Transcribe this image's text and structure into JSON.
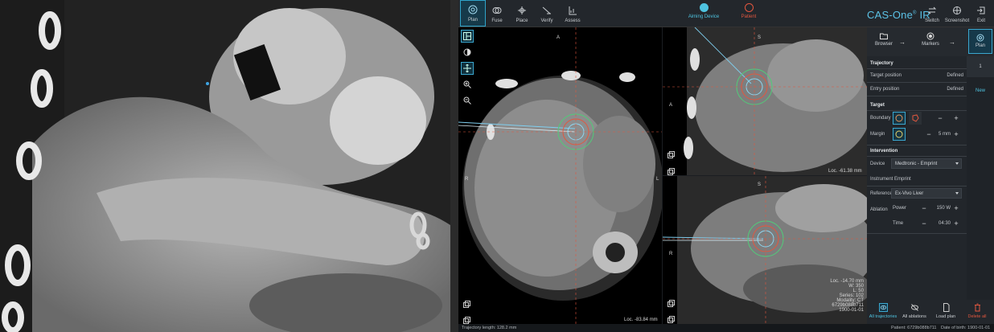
{
  "toolbar": {
    "tools": [
      {
        "label": "Plan",
        "icon": "plan-icon",
        "active": true
      },
      {
        "label": "Fuse",
        "icon": "fuse-icon"
      },
      {
        "label": "Place",
        "icon": "place-icon"
      },
      {
        "label": "Verify",
        "icon": "verify-icon"
      },
      {
        "label": "Assess",
        "icon": "assess-icon"
      }
    ],
    "status": [
      {
        "label": "Aiming Device",
        "color": "#4ec3e0"
      },
      {
        "label": "Patient",
        "color": "#e2573f"
      }
    ],
    "brand": "CAS-One",
    "brand_suffix": "IR",
    "brand_mark": "®",
    "actions": [
      {
        "label": "Switch",
        "icon": "switch-icon"
      },
      {
        "label": "Screenshot",
        "icon": "screenshot-icon"
      },
      {
        "label": "Exit",
        "icon": "exit-icon"
      }
    ]
  },
  "views": {
    "axial": {
      "orient_top": "A",
      "orient_right": "L",
      "orient_left": "R",
      "loc": "Loc. -83.84 mm"
    },
    "sagittal": {
      "orient_top": "S",
      "orient_left": "A",
      "loc": "Loc. -61.38 mm"
    },
    "coronal": {
      "orient_top": "S",
      "orient_left": "R",
      "loc": "Loc. -14.70 mm",
      "w": "W: 350",
      "l": "L: 50",
      "series": "Series: 102",
      "modality": "Modality: CT",
      "id": "6729b088b711",
      "date": "1900-01-01"
    }
  },
  "wizard": {
    "steps": [
      {
        "label": "Browser",
        "icon": "folder-icon"
      },
      {
        "label": "Markers",
        "icon": "marker-icon"
      },
      {
        "label": "Plan",
        "icon": "plan-icon"
      }
    ]
  },
  "trajectory": {
    "title": "Trajectory",
    "target_label": "Target position",
    "target_value": "Defined",
    "entry_label": "Entry position",
    "entry_value": "Defined",
    "tabs": [
      "1",
      "New"
    ]
  },
  "target": {
    "title": "Target",
    "boundary_label": "Boundary",
    "margin_label": "Margin",
    "margin_value": "5 mm"
  },
  "intervention": {
    "title": "Intervention",
    "device_label": "Device",
    "device_value": "Medtronic - Emprint",
    "instrument_label": "Instrument",
    "instrument_value": "Emprint",
    "reference_label": "Reference",
    "reference_value": "Ex-Vivo Liver",
    "ablation_label": "Ablation",
    "power_label": "Power",
    "power_value": "150 W",
    "time_label": "Time",
    "time_value": "04:30"
  },
  "bottom": [
    {
      "label": "All trajectories",
      "icon": "eye-icon",
      "active": true
    },
    {
      "label": "All ablations",
      "icon": "eye-off-icon"
    },
    {
      "label": "Load plan",
      "icon": "file-icon"
    },
    {
      "label": "Delete all",
      "icon": "trash-icon",
      "color": "#e2573f"
    }
  ],
  "status_bar": {
    "trajectory_length": "Trajectory length: 128.2 mm",
    "patient": "Patient: 6729b088b711",
    "dob": "Date of birth: 1900-01-01"
  }
}
